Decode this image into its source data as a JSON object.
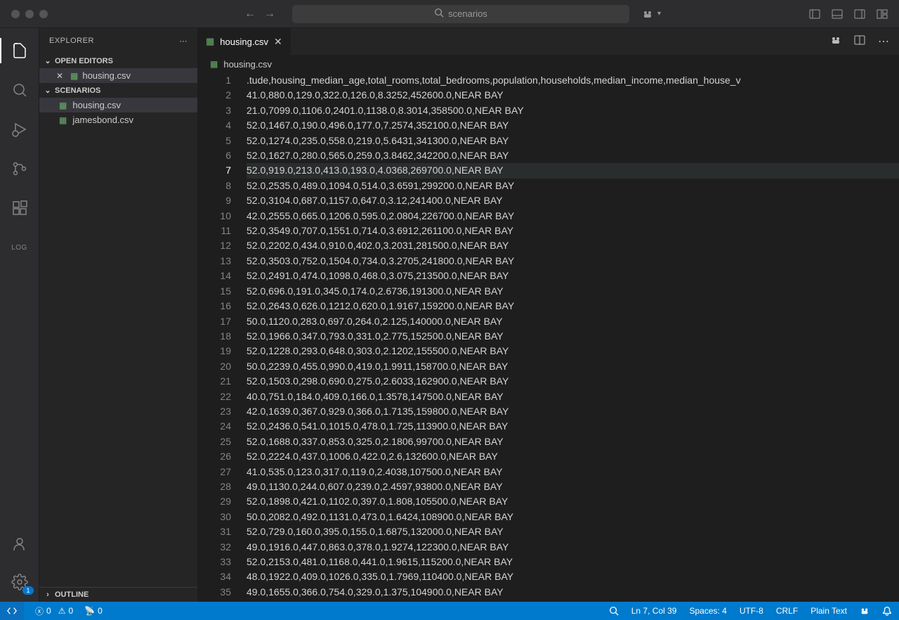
{
  "titlebar": {
    "search_text": "scenarios"
  },
  "sidebar": {
    "title": "EXPLORER",
    "open_editors_label": "OPEN EDITORS",
    "open_editor_file": "housing.csv",
    "folder_label": "SCENARIOS",
    "files": [
      "housing.csv",
      "jamesbond.csv"
    ],
    "outline_label": "OUTLINE"
  },
  "tab": {
    "label": "housing.csv"
  },
  "breadcrumb": {
    "file": "housing.csv"
  },
  "gear_badge": "1",
  "editor": {
    "active_line_index": 6,
    "lines": [
      ".tude,housing_median_age,total_rooms,total_bedrooms,population,households,median_income,median_house_v",
      "41.0,880.0,129.0,322.0,126.0,8.3252,452600.0,NEAR BAY",
      "21.0,7099.0,1106.0,2401.0,1138.0,8.3014,358500.0,NEAR BAY",
      "52.0,1467.0,190.0,496.0,177.0,7.2574,352100.0,NEAR BAY",
      "52.0,1274.0,235.0,558.0,219.0,5.6431,341300.0,NEAR BAY",
      "52.0,1627.0,280.0,565.0,259.0,3.8462,342200.0,NEAR BAY",
      "52.0,919.0,213.0,413.0,193.0,4.0368,269700.0,NEAR BAY",
      "52.0,2535.0,489.0,1094.0,514.0,3.6591,299200.0,NEAR BAY",
      "52.0,3104.0,687.0,1157.0,647.0,3.12,241400.0,NEAR BAY",
      "42.0,2555.0,665.0,1206.0,595.0,2.0804,226700.0,NEAR BAY",
      "52.0,3549.0,707.0,1551.0,714.0,3.6912,261100.0,NEAR BAY",
      "52.0,2202.0,434.0,910.0,402.0,3.2031,281500.0,NEAR BAY",
      "52.0,3503.0,752.0,1504.0,734.0,3.2705,241800.0,NEAR BAY",
      "52.0,2491.0,474.0,1098.0,468.0,3.075,213500.0,NEAR BAY",
      "52.0,696.0,191.0,345.0,174.0,2.6736,191300.0,NEAR BAY",
      "52.0,2643.0,626.0,1212.0,620.0,1.9167,159200.0,NEAR BAY",
      "50.0,1120.0,283.0,697.0,264.0,2.125,140000.0,NEAR BAY",
      "52.0,1966.0,347.0,793.0,331.0,2.775,152500.0,NEAR BAY",
      "52.0,1228.0,293.0,648.0,303.0,2.1202,155500.0,NEAR BAY",
      "50.0,2239.0,455.0,990.0,419.0,1.9911,158700.0,NEAR BAY",
      "52.0,1503.0,298.0,690.0,275.0,2.6033,162900.0,NEAR BAY",
      "40.0,751.0,184.0,409.0,166.0,1.3578,147500.0,NEAR BAY",
      "42.0,1639.0,367.0,929.0,366.0,1.7135,159800.0,NEAR BAY",
      "52.0,2436.0,541.0,1015.0,478.0,1.725,113900.0,NEAR BAY",
      "52.0,1688.0,337.0,853.0,325.0,2.1806,99700.0,NEAR BAY",
      "52.0,2224.0,437.0,1006.0,422.0,2.6,132600.0,NEAR BAY",
      "41.0,535.0,123.0,317.0,119.0,2.4038,107500.0,NEAR BAY",
      "49.0,1130.0,244.0,607.0,239.0,2.4597,93800.0,NEAR BAY",
      "52.0,1898.0,421.0,1102.0,397.0,1.808,105500.0,NEAR BAY",
      "50.0,2082.0,492.0,1131.0,473.0,1.6424,108900.0,NEAR BAY",
      "52.0,729.0,160.0,395.0,155.0,1.6875,132000.0,NEAR BAY",
      "49.0,1916.0,447.0,863.0,378.0,1.9274,122300.0,NEAR BAY",
      "52.0,2153.0,481.0,1168.0,441.0,1.9615,115200.0,NEAR BAY",
      "48.0,1922.0,409.0,1026.0,335.0,1.7969,110400.0,NEAR BAY",
      "49.0,1655.0,366.0,754.0,329.0,1.375,104900.0,NEAR BAY"
    ]
  },
  "status": {
    "errors": "0",
    "warnings": "0",
    "ports": "0",
    "cursor": "Ln 7, Col 39",
    "spaces": "Spaces: 4",
    "encoding": "UTF-8",
    "eol": "CRLF",
    "language": "Plain Text"
  }
}
